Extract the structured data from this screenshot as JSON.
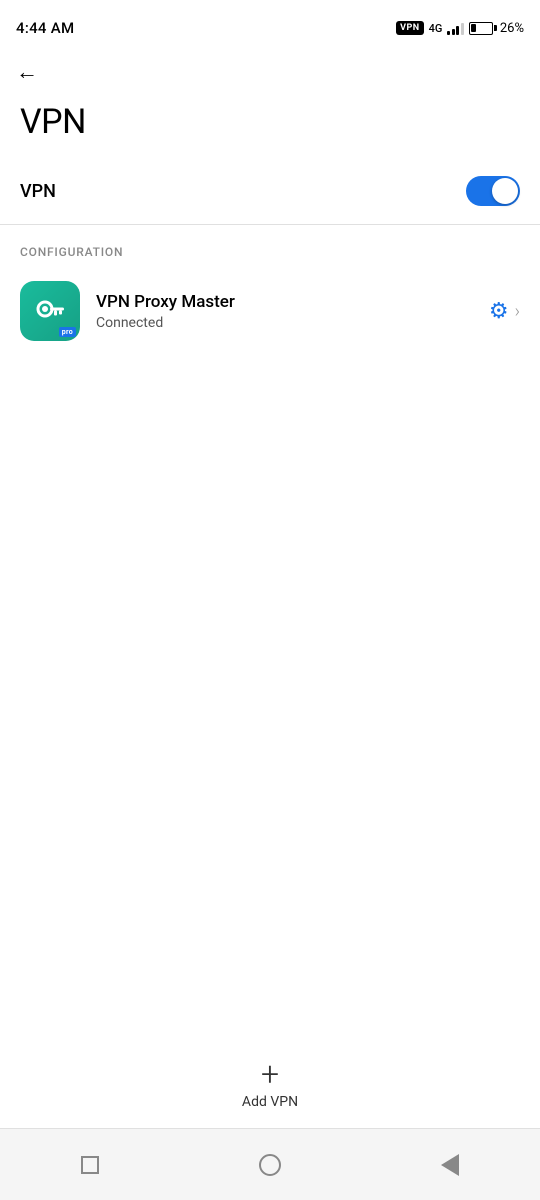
{
  "statusBar": {
    "time": "4:44 AM",
    "vpnBadge": "VPN",
    "networkType": "4G",
    "batteryPercent": "26%"
  },
  "header": {
    "backLabel": "←",
    "title": "VPN"
  },
  "vpnToggle": {
    "label": "VPN",
    "enabled": true
  },
  "configuration": {
    "sectionLabel": "CONFIGURATION",
    "vpnItem": {
      "name": "VPN Proxy Master",
      "status": "Connected",
      "proBadge": "pro"
    }
  },
  "addVpn": {
    "plusIcon": "+",
    "label": "Add VPN"
  },
  "bottomNav": {
    "items": [
      {
        "name": "recent-apps",
        "type": "square"
      },
      {
        "name": "home",
        "type": "circle"
      },
      {
        "name": "back",
        "type": "triangle"
      }
    ]
  }
}
